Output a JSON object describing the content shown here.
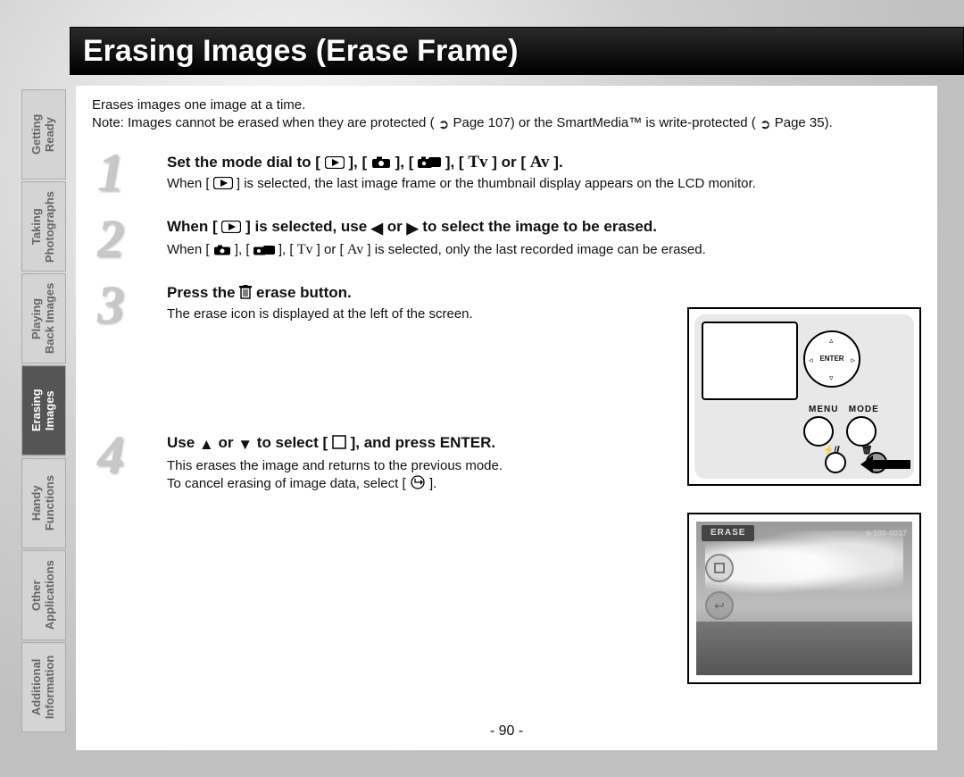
{
  "title": "Erasing Images (Erase Frame)",
  "sidebar": {
    "tabs": [
      {
        "label": "Getting\nReady"
      },
      {
        "label": "Taking\nPhotographs"
      },
      {
        "label": "Playing\nBack Images"
      },
      {
        "label": "Erasing\nImages"
      },
      {
        "label": "Handy\nFunctions"
      },
      {
        "label": "Other\nApplications"
      },
      {
        "label": "Additional\nInformation"
      }
    ],
    "active_index": 3
  },
  "intro": {
    "line1": "Erases images one image at a time.",
    "line2_a": "Note: Images cannot be erased when they are protected (",
    "line2_pageref1": " Page 107) or the SmartMedia™ is write-protected (",
    "line2_pageref2": " Page 35)."
  },
  "steps": {
    "s1": {
      "num": "1",
      "head_a": "Set the mode dial to [ ",
      "head_b": " ], [ ",
      "head_c": " ], [ ",
      "head_d": " ], [ ",
      "tv": "Tv",
      "head_e": " ] or [ ",
      "av": "Av",
      "head_f": " ].",
      "desc_a": "When [ ",
      "desc_b": " ] is selected, the last image frame or the thumbnail display appears on the LCD monitor."
    },
    "s2": {
      "num": "2",
      "head_a": "When [ ",
      "head_b": " ] is selected, use ",
      "head_c": " or ",
      "head_d": " to select the image to be erased.",
      "desc_a": "When [ ",
      "desc_b": " ], [ ",
      "desc_c": " ], [ ",
      "tv": "Tv",
      "desc_d": " ] or [ ",
      "av": "Av",
      "desc_e": " ] is selected, only the last recorded image can be erased."
    },
    "s3": {
      "num": "3",
      "head_a": "Press the ",
      "head_b": " erase button.",
      "desc": "The erase icon is displayed at the left of the screen."
    },
    "s4": {
      "num": "4",
      "head_a": "Use ",
      "head_b": " or ",
      "head_c": " to select [ ",
      "head_d": " ], and press ENTER.",
      "desc_a": "This erases the image and returns to the previous mode.",
      "desc_b_a": "To cancel erasing of image data, select [ ",
      "desc_b_b": " ]."
    }
  },
  "camera": {
    "enter": "ENTER",
    "menu": "MENU",
    "mode": "MODE",
    "flash_info": "⚡/𝒊",
    "trash": "🗑"
  },
  "lcd": {
    "erase_label": "ERASE",
    "frame_label": "▶100-0037"
  },
  "page_number": "- 90 -"
}
